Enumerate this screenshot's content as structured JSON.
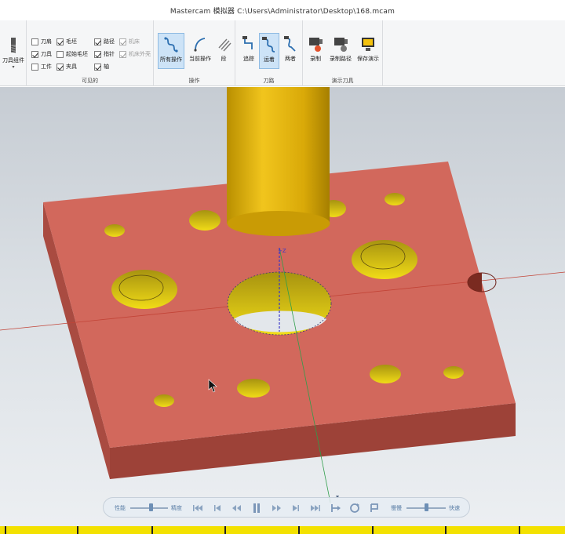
{
  "window": {
    "title": "Mastercam 模拟器  C:\\Users\\Administrator\\Desktop\\168.mcam"
  },
  "ribbon": {
    "tool_group": {
      "label": "刀具组件"
    },
    "visible": {
      "label": "可见的",
      "items": [
        {
          "label": "刀肩",
          "checked": false
        },
        {
          "label": "刀具",
          "checked": true
        },
        {
          "label": "工件",
          "checked": false
        },
        {
          "label": "毛坯",
          "checked": true
        },
        {
          "label": "起始毛坯",
          "checked": false
        },
        {
          "label": "夹具",
          "checked": true
        },
        {
          "label": "路径",
          "checked": true
        },
        {
          "label": "指针",
          "checked": true
        },
        {
          "label": "轴",
          "checked": true
        },
        {
          "label": "机床",
          "checked": true,
          "disabled": true
        },
        {
          "label": "机床外壳",
          "checked": true,
          "disabled": true
        }
      ]
    },
    "operations": {
      "label": "操作",
      "buttons": [
        {
          "label": "所有操作",
          "active": true
        },
        {
          "label": "当前操作",
          "active": false
        },
        {
          "label": "段",
          "active": false
        }
      ]
    },
    "toolpath": {
      "label": "刀路",
      "buttons": [
        {
          "label": "追踪",
          "active": false
        },
        {
          "label": "运着",
          "active": true
        },
        {
          "label": "两者",
          "active": false
        }
      ]
    },
    "demo": {
      "label": "演示刀具",
      "buttons": [
        {
          "label": "录制"
        },
        {
          "label": "录制路径"
        },
        {
          "label": "保存演示"
        }
      ]
    }
  },
  "viewport": {
    "axis_label": "+Z"
  },
  "playback": {
    "quality_left": "性能",
    "quality_right": "精度",
    "speed_left": "慢慢",
    "speed_right": "快速",
    "quality_level": 0.55,
    "speed_level": 0.5
  },
  "colors": {
    "plate_top": "#d2685c",
    "plate_side": "#a84a40",
    "tool": "#e3b50b",
    "hole_wall": "#e0cc10",
    "timeline": "#f3e100",
    "active_button": "#cde3f7"
  }
}
